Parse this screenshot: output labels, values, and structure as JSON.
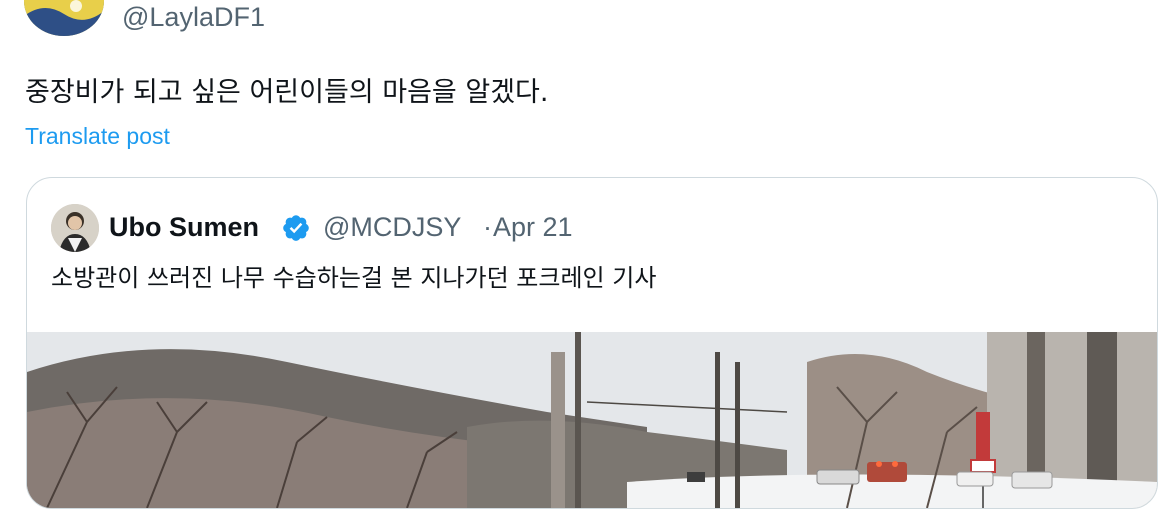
{
  "post": {
    "handle": "@LaylaDF1",
    "text": "중장비가 되고 싶은 어린이들의 마음을 알겠다.",
    "translate_label": "Translate post"
  },
  "quoted": {
    "name": "Ubo Sumen",
    "handle": "@MCDJSY",
    "separator": "·",
    "date": "Apr 21",
    "verified": true,
    "text": "소방관이 쓰러진 나무 수습하는걸 본 지나가던 포크레인 기사"
  },
  "colors": {
    "link": "#1d9bf0",
    "muted": "#536471",
    "border": "#cfd9de",
    "verified": "#1d9bf0"
  },
  "icons": {
    "verified": "verified-badge-icon"
  }
}
